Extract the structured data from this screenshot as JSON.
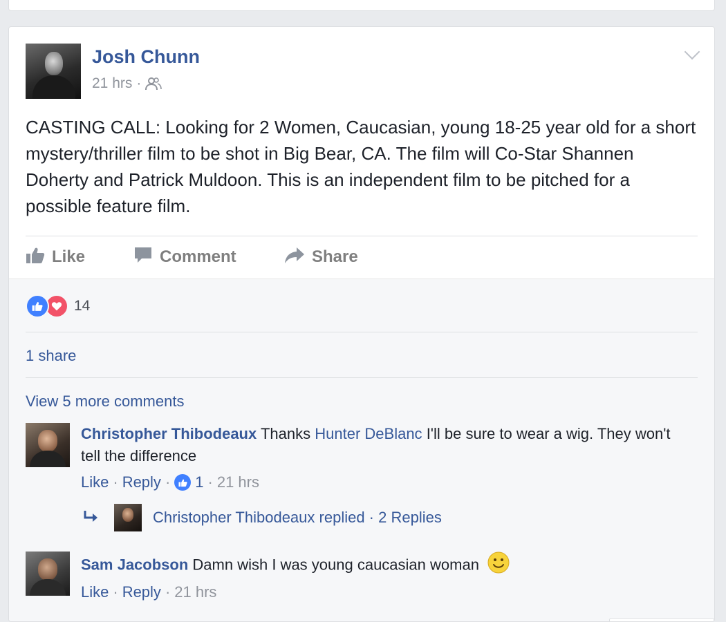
{
  "post": {
    "author": "Josh Chunn",
    "time": "21 hrs",
    "dot": "·",
    "audience_icon": "friends-icon",
    "text": "CASTING CALL: Looking for 2 Women, Caucasian, young 18-25 year old for a short mystery/thriller film to be shot in Big Bear, CA. The film will Co-Star Shannen Doherty and Patrick Muldoon. This is an independent film to be pitched for a possible feature film."
  },
  "actions": {
    "like": "Like",
    "comment": "Comment",
    "share": "Share"
  },
  "reactions": {
    "count": "14",
    "icons": [
      "like-reaction-icon",
      "love-reaction-icon"
    ],
    "like_color": "#4080ff",
    "love_color": "#f25268"
  },
  "shares": "1 share",
  "view_more_comments": "View 5 more comments",
  "comments": [
    {
      "author": "Christopher Thibodeaux",
      "text_before": "Thanks",
      "mention": "Hunter DeBlanc",
      "text_after": "I'll be sure to wear a wig. They won't tell the difference",
      "like": "Like",
      "reply": "Reply",
      "likes": "1",
      "time": "21 hrs",
      "replies_summary": "Christopher Thibodeaux replied · 2 Replies"
    },
    {
      "author": "Sam Jacobson",
      "text": "Damn wish I was young caucasian woman",
      "emoji": "smiley-face-icon",
      "like": "Like",
      "reply": "Reply",
      "time": "21 hrs"
    }
  ],
  "colors": {
    "link": "#365899",
    "meta": "#90949c",
    "background": "#e9ebee"
  }
}
